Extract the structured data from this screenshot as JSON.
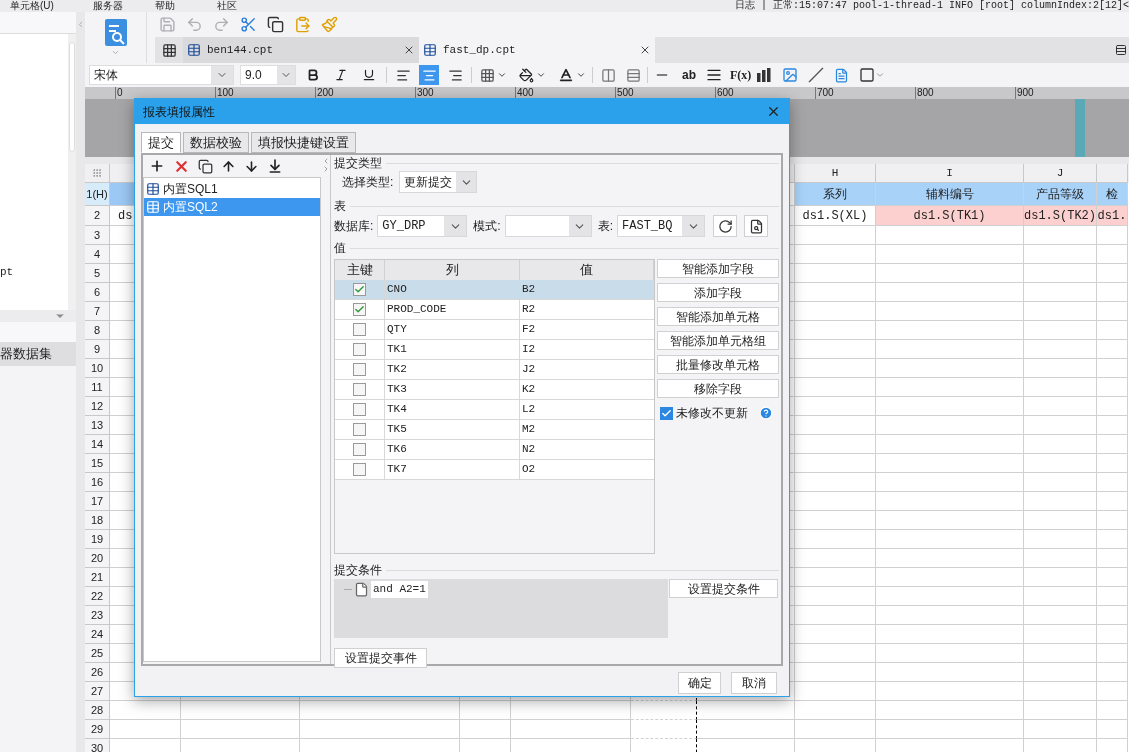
{
  "menu_bar": {
    "items": [
      "单元格(U)",
      "服务器",
      "帮助",
      "社区"
    ],
    "log": "日志 | 正常:15:07:47 pool-1-thread-1 INFO [root] columnIndex:2[12]<"
  },
  "left_panel": {
    "file_fragment": "pt",
    "section": "器数据集"
  },
  "edit_tools": [
    {
      "kind": "save",
      "disabled": true
    },
    {
      "kind": "undo",
      "disabled": true
    },
    {
      "kind": "redo",
      "disabled": true
    },
    {
      "kind": "cut",
      "disabled": false
    },
    {
      "kind": "copy",
      "disabled": false
    },
    {
      "kind": "paste",
      "disabled": false
    },
    {
      "kind": "brush",
      "disabled": false
    }
  ],
  "file_tabs": [
    {
      "label": "ben144.cpt",
      "selected": false
    },
    {
      "label": "fast_dp.cpt",
      "selected": true
    }
  ],
  "format_bar": {
    "font": "宋体",
    "size": "9.0",
    "align": [
      {
        "selected": false
      },
      {
        "selected": true
      },
      {
        "selected": false
      }
    ],
    "text_tools": [
      "ab",
      "F(x)"
    ]
  },
  "ruler": {
    "ticks": [
      "0",
      "100",
      "200",
      "300",
      "400",
      "500",
      "600",
      "700",
      "800",
      "900"
    ]
  },
  "sheet": {
    "first_column": {
      "formula": "ds"
    },
    "visible_columns": [
      {
        "label": "H",
        "header": "系列",
        "formula": "ds1.S(XL)",
        "marked": false
      },
      {
        "label": "I",
        "header": "辅料编号",
        "formula": "ds1.S(TK1)",
        "marked": true
      },
      {
        "label": "J",
        "header": "产品等级",
        "formula": "ds1.S(TK2)",
        "marked": true
      },
      {
        "header": "检",
        "formula": "ds1.",
        "marked": true
      }
    ],
    "row_numbers": [
      "1(H)",
      "2",
      "3",
      "4",
      "5",
      "6",
      "7",
      "8",
      "9",
      "10",
      "11",
      "12",
      "13",
      "14",
      "15",
      "16",
      "17",
      "18",
      "19",
      "20",
      "21",
      "22",
      "23",
      "24",
      "25",
      "26",
      "27",
      "28",
      "29",
      "30"
    ]
  },
  "dialog": {
    "title": "报表填报属性",
    "tabs": [
      {
        "label": "提交",
        "selected": true
      },
      {
        "label": "数据校验",
        "selected": false
      },
      {
        "label": "填报快捷键设置",
        "selected": false
      }
    ],
    "sql_items": [
      {
        "label": "内置SQL1",
        "selected": false
      },
      {
        "label": "内置SQL2",
        "selected": true
      }
    ],
    "submit_type": {
      "label": "提交类型",
      "field_label": "选择类型:",
      "value": "更新提交"
    },
    "table_section": {
      "label": "表",
      "database_label": "数据库:",
      "database": "GY_DRP",
      "schema_label": "模式:",
      "table_label": "表:",
      "table": "FAST_BQ"
    },
    "values": {
      "label": "值",
      "columns": [
        "主键",
        "列",
        "值"
      ],
      "rows": [
        {
          "key": true,
          "column": "CNO",
          "value": "B2",
          "selected": true
        },
        {
          "key": true,
          "column": "PROD_CODE",
          "value": "R2",
          "selected": false
        },
        {
          "key": false,
          "column": "QTY",
          "value": "F2",
          "selected": false
        },
        {
          "key": false,
          "column": "TK1",
          "value": "I2",
          "selected": false
        },
        {
          "key": false,
          "column": "TK2",
          "value": "J2",
          "selected": false
        },
        {
          "key": false,
          "column": "TK3",
          "value": "K2",
          "selected": false
        },
        {
          "key": false,
          "column": "TK4",
          "value": "L2",
          "selected": false
        },
        {
          "key": false,
          "column": "TK5",
          "value": "M2",
          "selected": false
        },
        {
          "key": false,
          "column": "TK6",
          "value": "N2",
          "selected": false
        },
        {
          "key": false,
          "column": "TK7",
          "value": "O2",
          "selected": false
        }
      ]
    },
    "side_buttons": [
      "智能添加字段",
      "添加字段",
      "智能添加单元格",
      "智能添加单元格组",
      "批量修改单元格",
      "移除字段"
    ],
    "no_update_checkbox": {
      "label": "未修改不更新",
      "checked": true
    },
    "condition": {
      "label": "提交条件",
      "items": [
        "and A2=1"
      ],
      "button": "设置提交条件"
    },
    "event_button": "设置提交事件",
    "buttons": [
      "确定",
      "取消"
    ]
  }
}
